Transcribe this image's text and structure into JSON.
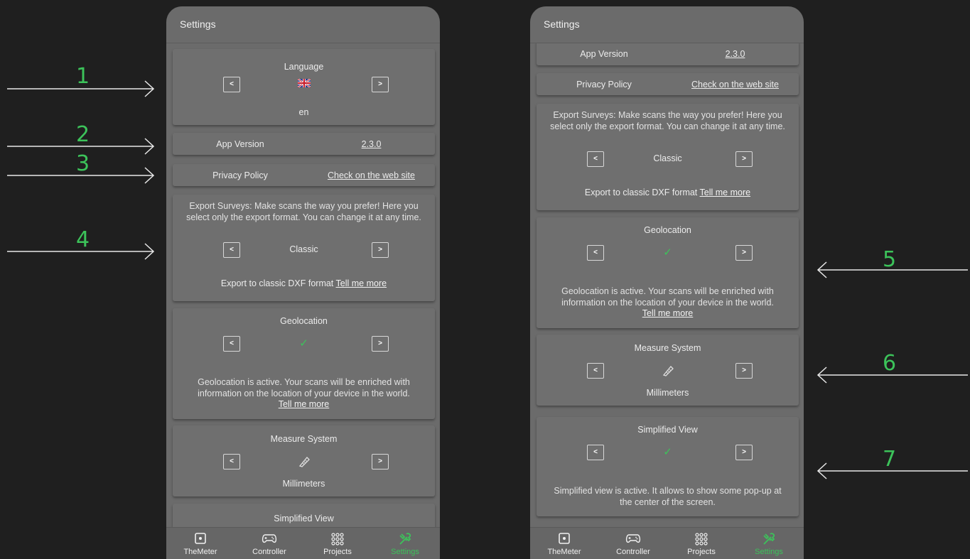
{
  "screen_title": "Settings",
  "language": {
    "title": "Language",
    "flag_icon": "uk-flag-icon",
    "value": "en"
  },
  "app_version": {
    "label": "App Version",
    "value": "2.3.0"
  },
  "privacy": {
    "label": "Privacy Policy",
    "link": "Check on the web site"
  },
  "export": {
    "description": "Export Surveys: Make scans the way you prefer! Here you select only the export format. You can change it at any time.",
    "value": "Classic",
    "note": "Export to classic DXF format",
    "link": "Tell me more"
  },
  "geolocation": {
    "title": "Geolocation",
    "status_icon": "check-icon",
    "description": "Geolocation is active. Your scans will be enriched with information on the location of your device in the world.",
    "link": "Tell me more"
  },
  "measure": {
    "title": "Measure System",
    "icon": "ruler-icon",
    "value": "Millimeters"
  },
  "simplified": {
    "title": "Simplified View",
    "status_icon": "check-icon",
    "description": "Simplified view is active. It allows to show some pop-up at the center of the screen."
  },
  "prev_symbol": "<",
  "next_symbol": ">",
  "check_symbol": "✓",
  "nav": [
    {
      "label": "TheMeter",
      "icon": "meter-icon"
    },
    {
      "label": "Controller",
      "icon": "gamepad-icon"
    },
    {
      "label": "Projects",
      "icon": "grid-icon"
    },
    {
      "label": "Settings",
      "icon": "tools-icon",
      "active": true
    }
  ],
  "annotations": [
    "1",
    "2",
    "3",
    "4",
    "5",
    "6",
    "7"
  ],
  "colors": {
    "accent": "#3cc35a",
    "background": "#1f1f1f",
    "panel": "#6b6b6b"
  }
}
